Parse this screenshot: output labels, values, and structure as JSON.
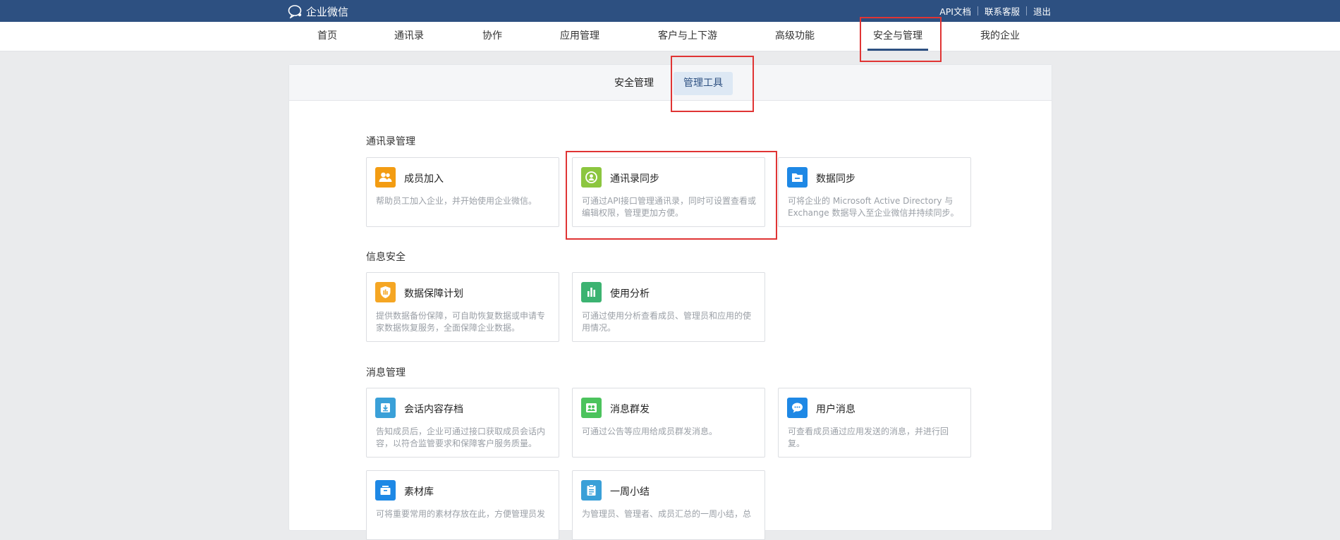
{
  "topbar": {
    "logo_text": "企业微信",
    "links": [
      "API文档",
      "联系客服",
      "退出"
    ]
  },
  "nav": {
    "items": [
      "首页",
      "通讯录",
      "协作",
      "应用管理",
      "客户与上下游",
      "高级功能",
      "安全与管理",
      "我的企业"
    ],
    "active": "安全与管理"
  },
  "subtabs": {
    "items": [
      "安全管理",
      "管理工具"
    ],
    "active": "管理工具"
  },
  "sections": [
    {
      "title": "通讯录管理",
      "cards": [
        {
          "title": "成员加入",
          "desc": "帮助员工加入企业，并开始使用企业微信。",
          "icon": "members-icon",
          "color": "#f39c12"
        },
        {
          "title": "通讯录同步",
          "desc": "可通过API接口管理通讯录，同时可设置查看或编辑权限，管理更加方便。",
          "icon": "contact-sync-icon",
          "color": "#8cc63f"
        },
        {
          "title": "数据同步",
          "desc": "可将企业的 Microsoft Active Directory 与 Exchange 数据导入至企业微信并持续同步。",
          "icon": "folder-icon",
          "color": "#1e88e5"
        }
      ]
    },
    {
      "title": "信息安全",
      "cards": [
        {
          "title": "数据保障计划",
          "desc": "提供数据备份保障，可自助恢复数据或申请专家数据恢复服务，全面保障企业数据。",
          "icon": "shield-icon",
          "color": "#f5a623"
        },
        {
          "title": "使用分析",
          "desc": "可通过使用分析查看成员、管理员和应用的使用情况。",
          "icon": "bar-chart-icon",
          "color": "#3cb371"
        }
      ]
    },
    {
      "title": "消息管理",
      "cards": [
        {
          "title": "会话内容存档",
          "desc": "告知成员后，企业可通过接口获取成员会话内容，以符合监管要求和保障客户服务质量。",
          "icon": "archive-icon",
          "color": "#3aa0d8"
        },
        {
          "title": "消息群发",
          "desc": "可通过公告等应用给成员群发消息。",
          "icon": "broadcast-icon",
          "color": "#4cc35d"
        },
        {
          "title": "用户消息",
          "desc": "可查看成员通过应用发送的消息，并进行回复。",
          "icon": "chat-bubble-icon",
          "color": "#1e88e5"
        },
        {
          "title": "素材库",
          "desc": "可将重要常用的素材存放在此，方便管理员发",
          "icon": "material-library-icon",
          "color": "#1e88e5"
        },
        {
          "title": "一周小结",
          "desc": "为管理员、管理者、成员汇总的一周小结，总",
          "icon": "clipboard-icon",
          "color": "#3aa0d8"
        }
      ]
    }
  ]
}
